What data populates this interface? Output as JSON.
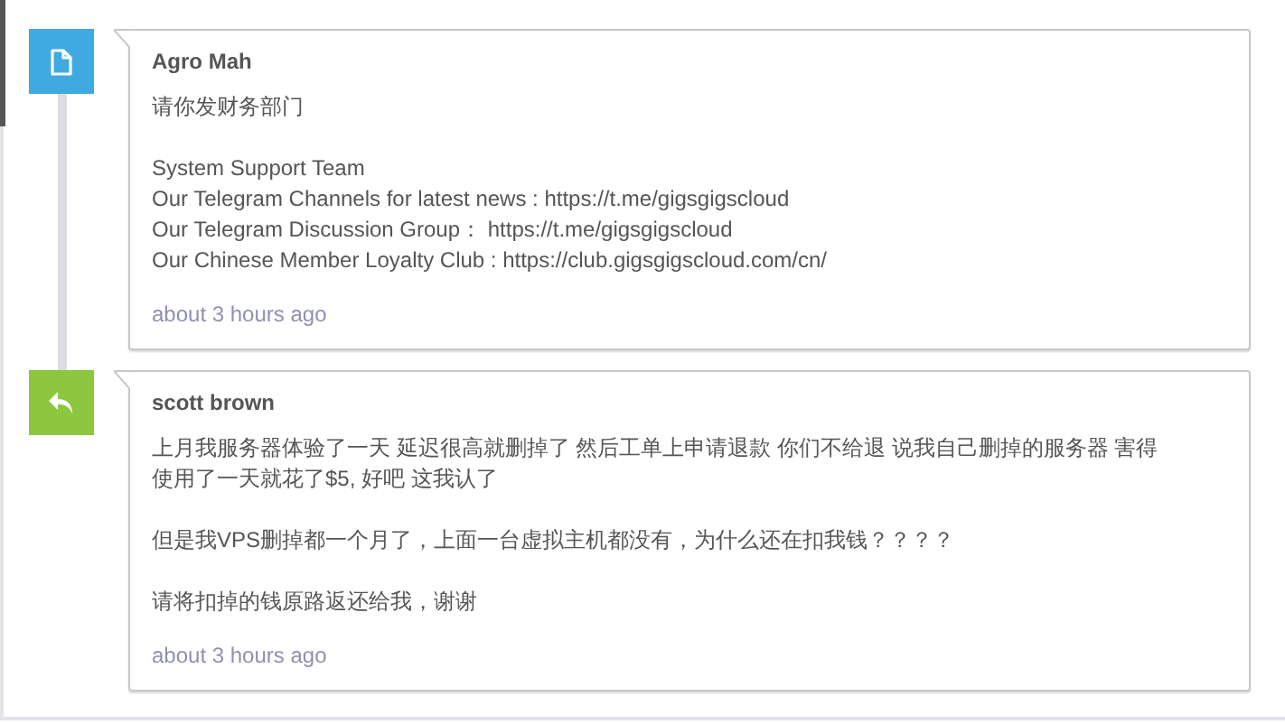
{
  "messages": [
    {
      "kind": "note",
      "author": "Agro Mah",
      "paragraphs": [
        [
          "请你发财务部门"
        ],
        [
          "System Support Team",
          "Our Telegram Channels for latest news : https://t.me/gigsgigscloud",
          "Our Telegram Discussion Group：  https://t.me/gigsgigscloud",
          "Our Chinese Member Loyalty Club : https://club.gigsgigscloud.com/cn/"
        ]
      ],
      "time": "about 3 hours ago"
    },
    {
      "kind": "reply",
      "author": "scott brown",
      "paragraphs": [
        [
          "上月我服务器体验了一天 延迟很高就删掉了 然后工单上申请退款 你们不给退 说我自己删掉的服务器 害得",
          "使用了一天就花了$5, 好吧 这我认了"
        ],
        [
          "但是我VPS删掉都一个月了，上面一台虚拟主机都没有，为什么还在扣我钱？？？？"
        ],
        [
          "请将扣掉的钱原路返还给我，谢谢"
        ]
      ],
      "time": "about 3 hours ago"
    }
  ]
}
